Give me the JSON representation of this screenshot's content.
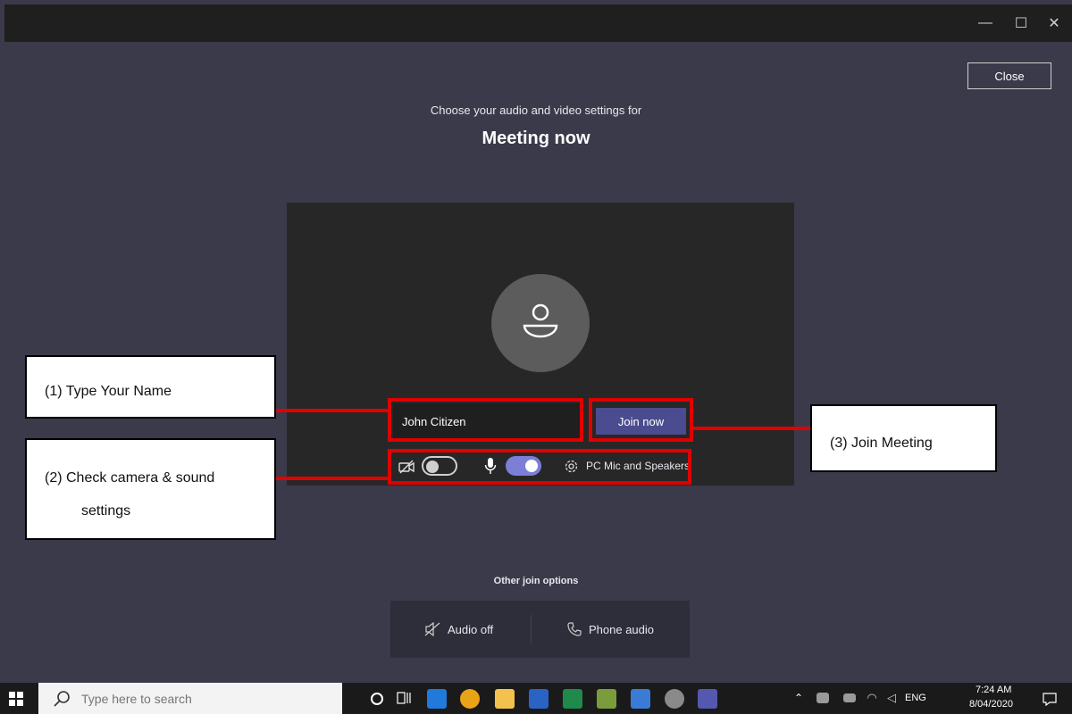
{
  "window": {
    "minimize_glyph": "—",
    "maximize_glyph": "☐",
    "close_glyph": "✕"
  },
  "close_button": "Close",
  "header": {
    "subtitle": "Choose your audio and video settings for",
    "title": "Meeting now"
  },
  "prejoin": {
    "name_value": "John Citizen",
    "join_label": "Join now",
    "camera_on": false,
    "mic_on": true,
    "device_label": "PC Mic and Speakers"
  },
  "callouts": {
    "one": "(1)  Type Your Name",
    "two_line1": "(2)  Check camera & sound",
    "two_line2": "settings",
    "three": "(3)  Join Meeting"
  },
  "other_join": {
    "label": "Other join options",
    "audio_off": "Audio off",
    "phone_audio": "Phone audio"
  },
  "taskbar": {
    "search_placeholder": "Type here to search",
    "tray_language": "ENG",
    "time": "7:24 AM",
    "date": "8/04/2020"
  },
  "colors": {
    "accent": "#4a4c8f",
    "toggle_on": "#7b7fd6",
    "annotation": "#e00000",
    "background": "#3b3a4a"
  }
}
